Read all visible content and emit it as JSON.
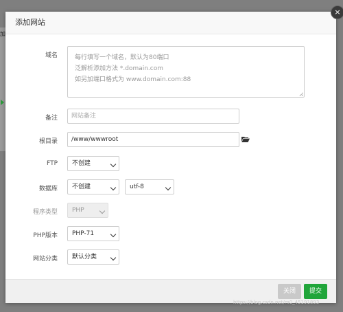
{
  "background": {
    "fragment": "加"
  },
  "modal": {
    "title": "添加网站",
    "close_glyph": "×"
  },
  "form": {
    "domain": {
      "label": "域名",
      "placeholder_lines": [
        "每行填写一个域名，默认为80端口",
        "泛解析添加方法 *.domain.com",
        "如另加端口格式为 www.domain.com:88"
      ]
    },
    "remark": {
      "label": "备注",
      "placeholder": "网站备注"
    },
    "root": {
      "label": "根目录",
      "value": "/www/wwwroot",
      "icon": "folder-open-icon"
    },
    "ftp": {
      "label": "FTP",
      "value": "不创建"
    },
    "database": {
      "label": "数据库",
      "value": "不创建",
      "charset": "utf-8"
    },
    "program_type": {
      "label": "程序类型",
      "value": "PHP"
    },
    "php_version": {
      "label": "PHP版本",
      "value": "PHP-71"
    },
    "category": {
      "label": "网站分类",
      "value": "默认分类"
    }
  },
  "footer": {
    "close_label": "关闭",
    "submit_label": "提交"
  },
  "watermark": "https://blog.csdn.net/m0_45191893",
  "colors": {
    "accent": "#20a53a",
    "disabled_button": "#c9c9c9",
    "overlay": "#7f7f7f"
  }
}
